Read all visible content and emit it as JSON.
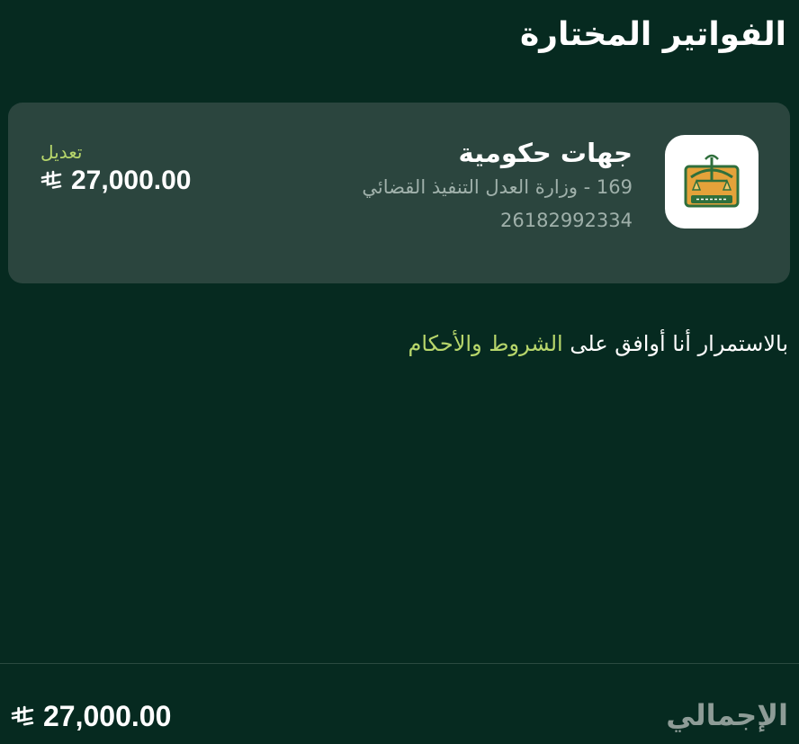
{
  "header": {
    "title": "الفواتير المختارة"
  },
  "bill": {
    "biller_name": "جهات حكومية",
    "service_line": "169 - وزارة العدل التنفيذ القضائي",
    "account_number": "26182992334",
    "edit_label": "تعديل",
    "amount": "27,000.00",
    "logo_icon": "ministry-of-justice-emblem-icon"
  },
  "terms": {
    "prefix": "بالاستمرار أنا أوافق على ",
    "link": "الشروط والأحكام"
  },
  "footer": {
    "total_label": "الإجمالي",
    "total_amount": "27,000.00"
  },
  "currency_icon": "saudi-riyal-icon",
  "colors": {
    "background": "#062a20",
    "card": "#2b453e",
    "accent": "#b7d66b"
  }
}
